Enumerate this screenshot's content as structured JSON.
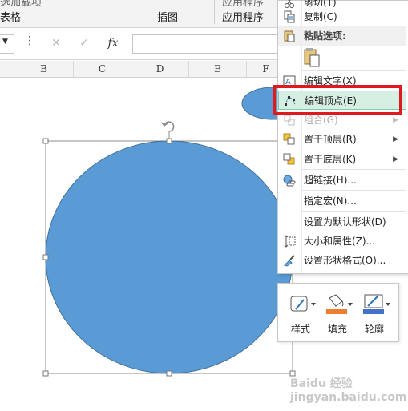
{
  "ribbon": {
    "group_table": "表格",
    "group_illustrations": "插图",
    "group_apps": "应用程序",
    "top_fragment_1": "选加载项",
    "top_fragment_2": "应用程序"
  },
  "formula_bar": {
    "cancel_glyph": "✕",
    "enter_glyph": "✓",
    "fx_glyph": "fx",
    "menu_glyph": "⋮",
    "value": ""
  },
  "columns": [
    "B",
    "C",
    "D",
    "E",
    "F"
  ],
  "context_menu": {
    "items": [
      {
        "label": "剪切(T)",
        "icon": "scissors-icon",
        "enabled": true
      },
      {
        "label": "复制(C)",
        "icon": "copy-icon",
        "enabled": true
      },
      {
        "label": "粘贴选项:",
        "icon": "paste-icon",
        "enabled": true,
        "bold": true
      },
      {
        "label": "编辑文字(X)",
        "icon": "edit-text-icon",
        "enabled": true
      },
      {
        "label": "编辑顶点(E)",
        "icon": "edit-points-icon",
        "enabled": true,
        "highlighted": true
      },
      {
        "label": "组合(G)",
        "icon": "group-icon",
        "enabled": false,
        "submenu": true
      },
      {
        "label": "置于顶层(R)",
        "icon": "bring-front-icon",
        "enabled": true,
        "submenu": true
      },
      {
        "label": "置于底层(K)",
        "icon": "send-back-icon",
        "enabled": true,
        "submenu": true
      },
      {
        "label": "超链接(H)...",
        "icon": "hyperlink-icon",
        "enabled": true
      },
      {
        "label": "指定宏(N)...",
        "icon": "",
        "enabled": true
      },
      {
        "label": "设置为默认形状(D)",
        "icon": "",
        "enabled": true
      },
      {
        "label": "大小和属性(Z)...",
        "icon": "size-props-icon",
        "enabled": true
      },
      {
        "label": "设置形状格式(O)...",
        "icon": "format-shape-icon",
        "enabled": true
      }
    ]
  },
  "mini_toolbar": {
    "style_label": "样式",
    "fill_label": "填充",
    "outline_label": "轮廓"
  },
  "colors": {
    "shape_fill": "#5b9bd5",
    "shape_stroke": "#41719c",
    "highlight_border": "#e0191f",
    "menu_hover": "#d7efe3",
    "fill_accent": "#ed7d31",
    "outline_accent": "#4472c4"
  },
  "watermark": "Baidu 经验 jingyan.baidu.com"
}
